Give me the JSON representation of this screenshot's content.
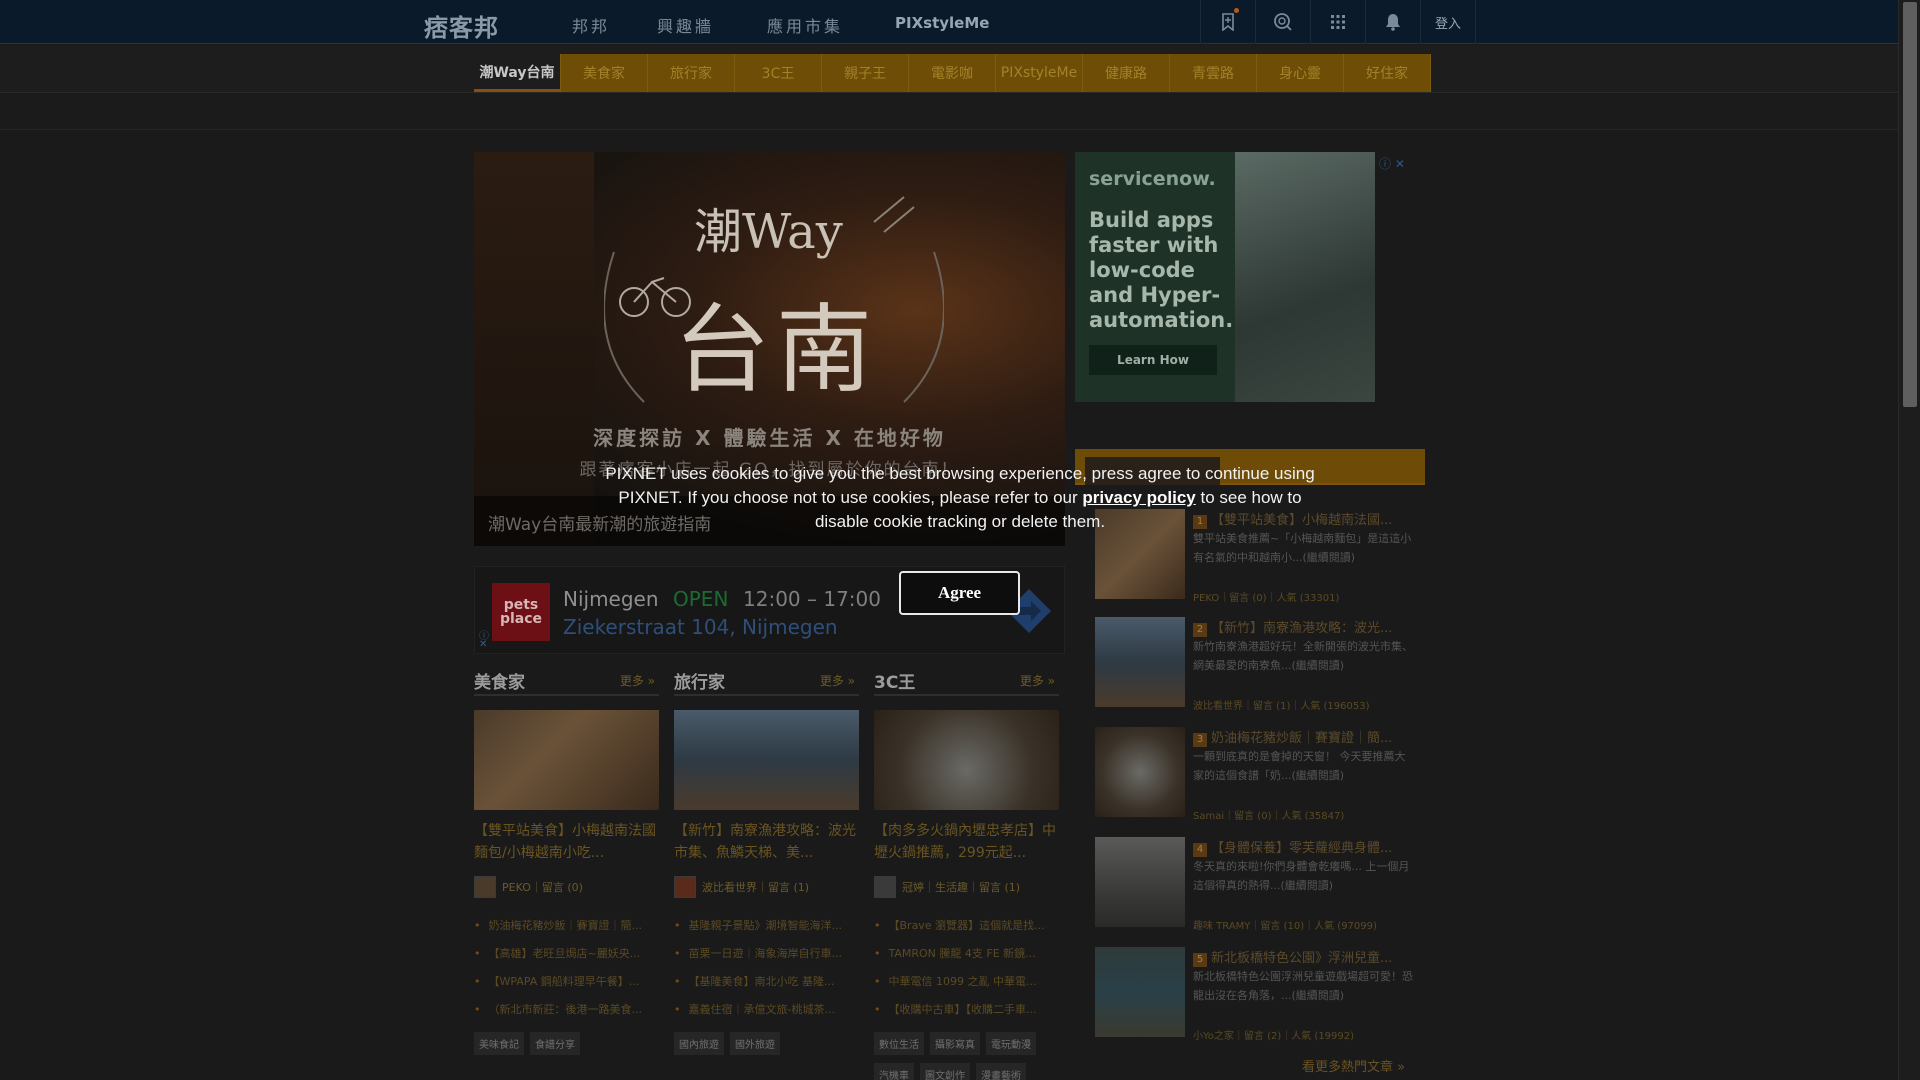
{
  "topnav": {
    "logo": "痞客邦",
    "items": [
      "邦邦",
      "興趣牆",
      "應用市集",
      "PIXstyleMe"
    ],
    "login": "登入",
    "icons": [
      "bookmark-icon",
      "search-icon",
      "apps-grid-icon",
      "bell-icon"
    ]
  },
  "categories": [
    "潮Way台南",
    "美食家",
    "旅行家",
    "3C王",
    "親子王",
    "電影咖",
    "PIXstyleMe",
    "健康路",
    "青雲路",
    "身心靈",
    "好住家"
  ],
  "hero": {
    "title_small": "潮Way",
    "title_big": "台南",
    "sub1": "深度探訪 X 體驗生活 X 在地好物",
    "sub2": "跟著痞客小店一起 GO，找到屬於你的台南！",
    "caption": "潮Way台南最新潮的旅遊指南"
  },
  "local_ad": {
    "logo": "pets place",
    "city": "Nijmegen",
    "open": "OPEN",
    "hours": "12:00 – 17:00",
    "street": "Ziekerstraat 104, Nijmegen"
  },
  "columns": [
    {
      "title": "美食家",
      "more": "更多 »",
      "headline": "【雙平站美食】小梅越南法國麵包/小梅越南小吃...",
      "author": "PEKO｜留言 (0)",
      "list": [
        "奶油梅花豬炒飯｜賽寶證｜簡...",
        "【高雄】老旺旦焗店~麗妖央...",
        "【WPAPA 鋼船料理早午餐】...",
        "（新北市新莊：後港一路美食..."
      ],
      "tags": [
        "美味食記",
        "食譜分享"
      ]
    },
    {
      "title": "旅行家",
      "more": "更多 »",
      "headline": "【新竹】南寮漁港攻略：波光市集、魚鱗天梯、美...",
      "author": "波比看世界｜留言 (1)",
      "list": [
        "基隆親子景點》潮境智能海洋...",
        "苗栗一日遊｜海象海岸自行車...",
        "【基隆美食】南北小吃 基隆...",
        "嘉義住宿｜承億文旅-桃城茶..."
      ],
      "tags": [
        "國內旅遊",
        "國外旅遊"
      ]
    },
    {
      "title": "3C王",
      "more": "更多 »",
      "headline": "【肉多多火鍋內壢忠孝店】中壢火鍋推薦，299元起...",
      "author": "冠婷｜生活趣｜留言 (1)",
      "list": [
        "【Brave 瀏覽器】這個就是找...",
        "TAMRON 騰龍 4支 FE 新鏡...",
        "中華電信 1099 之亂 中華電...",
        "【收購中古車】【收購二手車..."
      ],
      "tags": [
        "數位生活",
        "攝影寫真",
        "電玩動漫",
        "汽機車",
        "圖文創作",
        "漫畫藝術"
      ]
    }
  ],
  "right_ad": {
    "brand": "servicenow.",
    "headline": "Build apps faster with low-code and Hyper-automation.",
    "cta": "Learn How"
  },
  "hot_articles": [
    {
      "rank": "1",
      "title": "【雙平站美食】小梅越南法國...",
      "desc": "雙平站美食推薦~「小梅越南麵包」是這這小有名氣的中和越南小...(繼續閱讀)",
      "meta": "PEKO｜留言 (0)｜人氣 (33301)"
    },
    {
      "rank": "2",
      "title": "【新竹】南寮漁港攻略：波光...",
      "desc": "新竹南寮漁港超好玩！全新開張的波光市集、網美最愛的南寮魚...(繼續閱讀)",
      "meta": "波比看世界｜留言 (1)｜人氣 (196053)"
    },
    {
      "rank": "3",
      "title": "奶油梅花豬炒飯｜賽寶證｜簡...",
      "desc": "一顆到底真的是會掉的天窗！ 今天要推薦大家的這個食譜「奶...(繼續閱讀)",
      "meta": "Samai｜留言 (0)｜人氣 (35847)"
    },
    {
      "rank": "4",
      "title": "【身體保養】零芙蘿經典身體...",
      "desc": "冬天真的來啦!你們身體會乾癢嗎... 上一個月這個得真的熱得...(繼續閱讀)",
      "meta": "趣味 TRAMY｜留言 (10)｜人氣 (97099)"
    },
    {
      "rank": "5",
      "title": "新北板橋特色公園》浮洲兒童...",
      "desc": "新北板橋特色公園浮洲兒童遊戲場超可愛！恐龍出沒在各角落，...(繼續閱讀)",
      "meta": "小Yo之家｜留言 (2)｜人氣 (19992)"
    }
  ],
  "hot_more": "看更多熱門文章 »",
  "cookie": {
    "text_before": "PIXNET uses cookies to give you the best browsing experience, press agree to continue using PIXNET. If you choose not to use cookies, please refer to our ",
    "link": "privacy policy",
    "text_after": " to see how to disable cookie tracking or delete them.",
    "agree": "Agree"
  },
  "colors": {
    "topnav_bg": "#0b1a2a",
    "category_bg": "#6e4e06",
    "overlay": "rgba(0,0,0,0.6)"
  }
}
